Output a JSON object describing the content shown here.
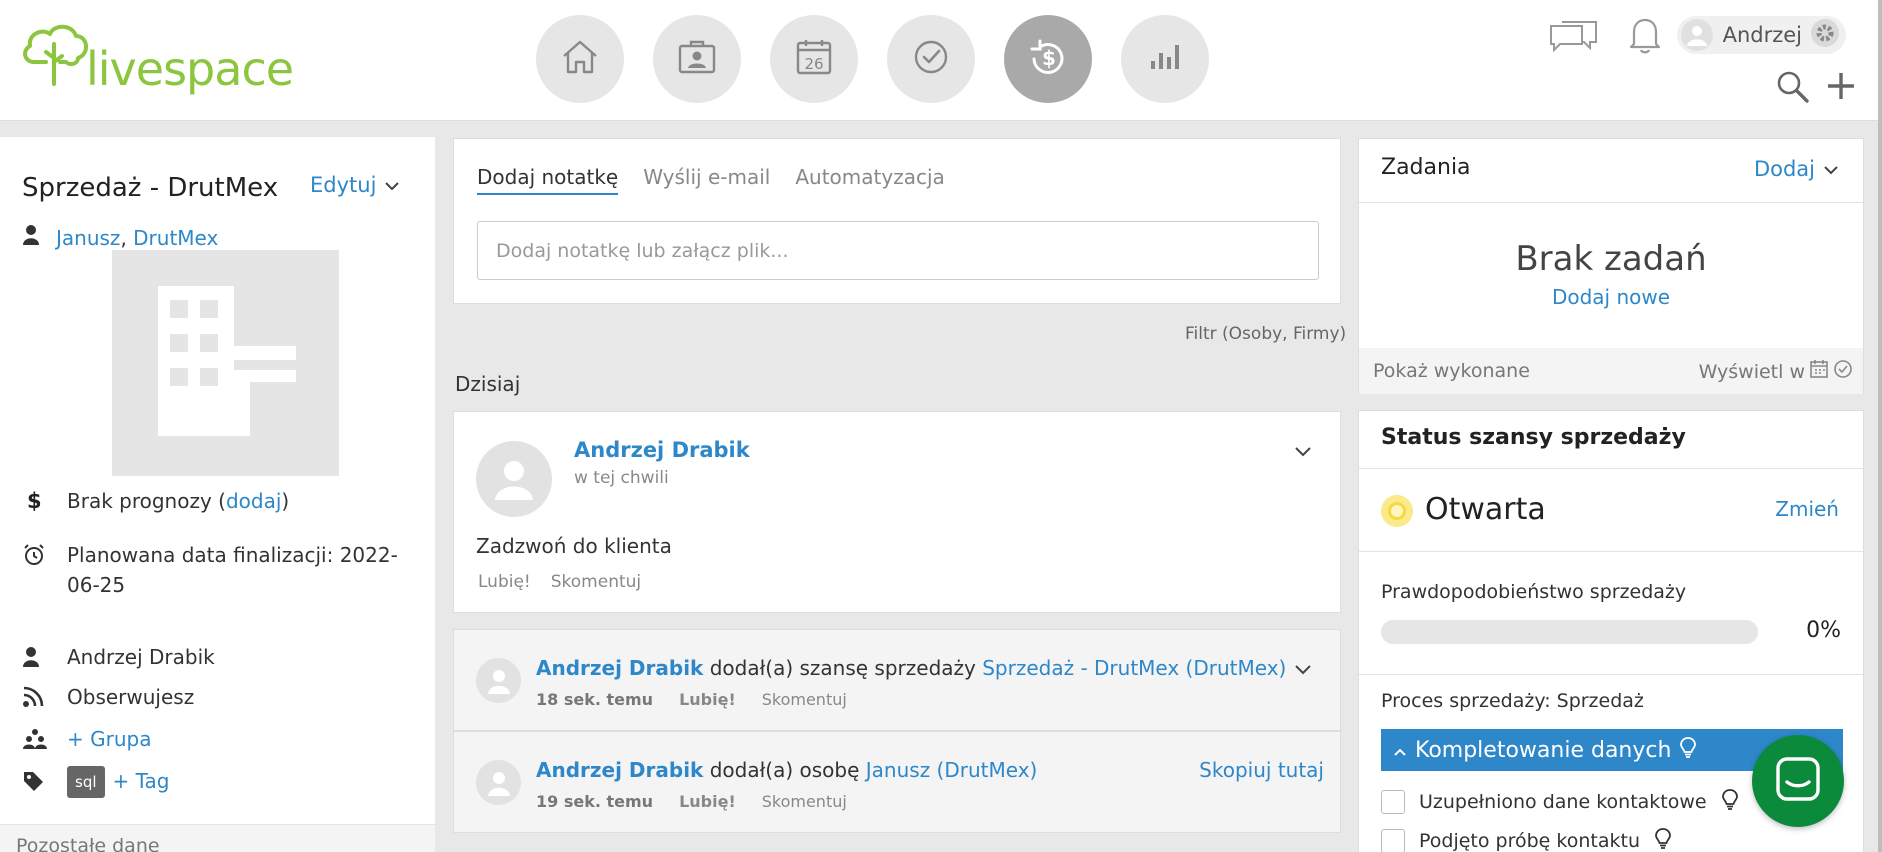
{
  "brand": {
    "name": "livespace",
    "color": "#8cc63f"
  },
  "accent_color": "#2e87c8",
  "nav": [
    {
      "icon": "home-icon",
      "active": false
    },
    {
      "icon": "contacts-icon",
      "active": false
    },
    {
      "icon": "calendar-icon",
      "active": false,
      "day": "26"
    },
    {
      "icon": "tasks-check-icon",
      "active": false
    },
    {
      "icon": "sales-deals-icon",
      "active": true
    },
    {
      "icon": "reports-chart-icon",
      "active": false
    }
  ],
  "user": {
    "name": "Andrzej"
  },
  "deal": {
    "title": "Sprzedaż - DrutMex",
    "edit_label": "Edytuj",
    "contact_person": "Janusz",
    "contact_sep": ",",
    "contact_company": "DrutMex",
    "forecast_prefix": "Brak prognozy (",
    "forecast_link": "dodaj",
    "forecast_suffix": ")",
    "finalization_date": "Planowana data finalizacji: 2022-06-25",
    "owner": "Andrzej Drabik",
    "following": "Obserwujesz",
    "group_link": "+ Grupa",
    "tag_name": "sql",
    "tag_add": "+ Tag",
    "other_data": "Pozostałe dane"
  },
  "composer": {
    "tabs": [
      {
        "label": "Dodaj notatkę",
        "active": true
      },
      {
        "label": "Wyślij e-mail",
        "active": false
      },
      {
        "label": "Automatyzacja",
        "active": false
      }
    ],
    "placeholder": "Dodaj notatkę lub załącz plik..."
  },
  "feed": {
    "filter": "Filtr (Osoby, Firmy)",
    "day_label": "Dzisiaj",
    "post": {
      "author": "Andrzej Drabik",
      "time": "w tej chwili",
      "text": "Zadzwoń do klienta",
      "like": "Lubię!",
      "comment": "Skomentuj"
    },
    "activities": [
      {
        "author": "Andrzej Drabik",
        "action": " dodał(a) szansę sprzedaży ",
        "target": "Sprzedaż - DrutMex (DrutMex)",
        "time": "18 sek. temu",
        "like": "Lubię!",
        "comment": "Skomentuj",
        "right": ""
      },
      {
        "author": "Andrzej Drabik",
        "action": " dodał(a) osobę ",
        "target": "Janusz (DrutMex)",
        "time": "19 sek. temu",
        "like": "Lubię!",
        "comment": "Skomentuj",
        "right": "Skopiuj tutaj"
      }
    ]
  },
  "tasks": {
    "title": "Zadania",
    "add_label": "Dodaj",
    "empty_title": "Brak zadań",
    "add_new": "Dodaj nowe",
    "show_done": "Pokaż wykonane",
    "view_in": "Wyświetl w"
  },
  "status": {
    "title": "Status szansy sprzedaży",
    "state": "Otwarta",
    "change_label": "Zmień",
    "probability_label": "Prawdopodobieństwo sprzedaży",
    "probability_value": "0%",
    "probability_fraction": 0,
    "process_label": "Proces sprzedaży: Sprzedaż",
    "stage": "Kompletowanie danych",
    "checklist": [
      {
        "label": "Uzupełniono dane kontaktowe",
        "checked": false
      },
      {
        "label": "Podjęto próbę kontaktu",
        "checked": false
      }
    ]
  },
  "chat_button_color": "#0b8a3c"
}
